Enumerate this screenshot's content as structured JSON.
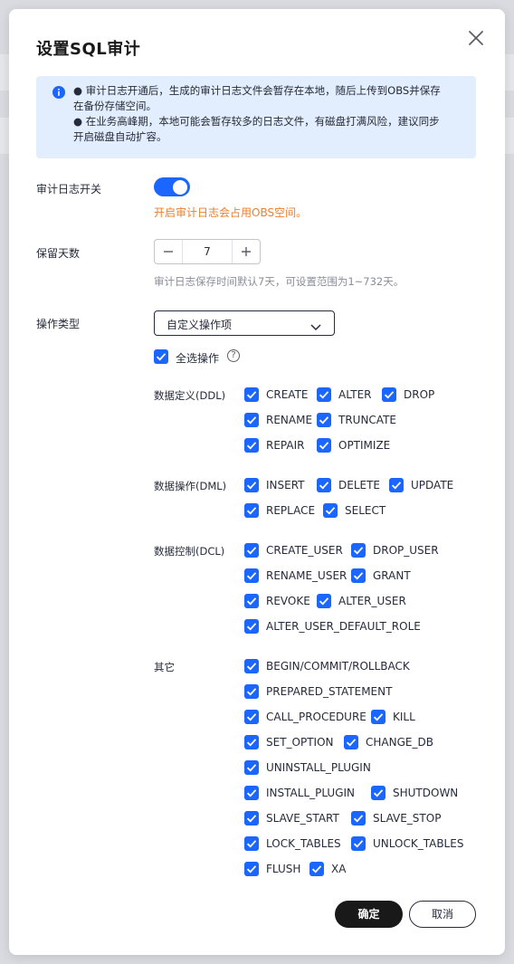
{
  "dialog": {
    "title": "设置SQL审计",
    "info": {
      "line1": "● 审计日志开通后，生成的审计日志文件会暂存在本地，随后上传到OBS并保存",
      "line2": "在备份存储空间。",
      "line3": "● 在业务高峰期，本地可能会暂存较多的日志文件，有磁盘打满风险，建议同步",
      "line4": "开启磁盘自动扩容。"
    },
    "audit_switch": {
      "label": "审计日志开关",
      "enabled": true,
      "warning": "开启审计日志会占用OBS空间。"
    },
    "retention": {
      "label": "保留天数",
      "value": "7",
      "hint": "审计日志保存时间默认7天，可设置范围为1~732天。"
    },
    "op_type": {
      "label": "操作类型",
      "selected": "自定义操作项",
      "select_all": "全选操作",
      "groups": [
        {
          "label": "数据定义(DDL)",
          "items": [
            "CREATE",
            "ALTER",
            "DROP",
            "RENAME",
            "TRUNCATE",
            "REPAIR",
            "OPTIMIZE"
          ]
        },
        {
          "label": "数据操作(DML)",
          "items": [
            "INSERT",
            "DELETE",
            "UPDATE",
            "REPLACE",
            "SELECT"
          ]
        },
        {
          "label": "数据控制(DCL)",
          "items": [
            "CREATE_USER",
            "DROP_USER",
            "RENAME_USER",
            "GRANT",
            "REVOKE",
            "ALTER_USER",
            "ALTER_USER_DEFAULT_ROLE"
          ]
        },
        {
          "label": "其它",
          "items": [
            "BEGIN/COMMIT/ROLLBACK",
            "PREPARED_STATEMENT",
            "CALL_PROCEDURE",
            "KILL",
            "SET_OPTION",
            "CHANGE_DB",
            "UNINSTALL_PLUGIN",
            "INSTALL_PLUGIN",
            "SHUTDOWN",
            "SLAVE_START",
            "SLAVE_STOP",
            "LOCK_TABLES",
            "UNLOCK_TABLES",
            "FLUSH",
            "XA"
          ]
        }
      ]
    },
    "buttons": {
      "ok": "确定",
      "cancel": "取消"
    }
  },
  "colors": {
    "primary": "#1a66ff",
    "warning": "#ef7d2c",
    "info_bg": "#e2edfd",
    "dark_button": "#191919"
  }
}
